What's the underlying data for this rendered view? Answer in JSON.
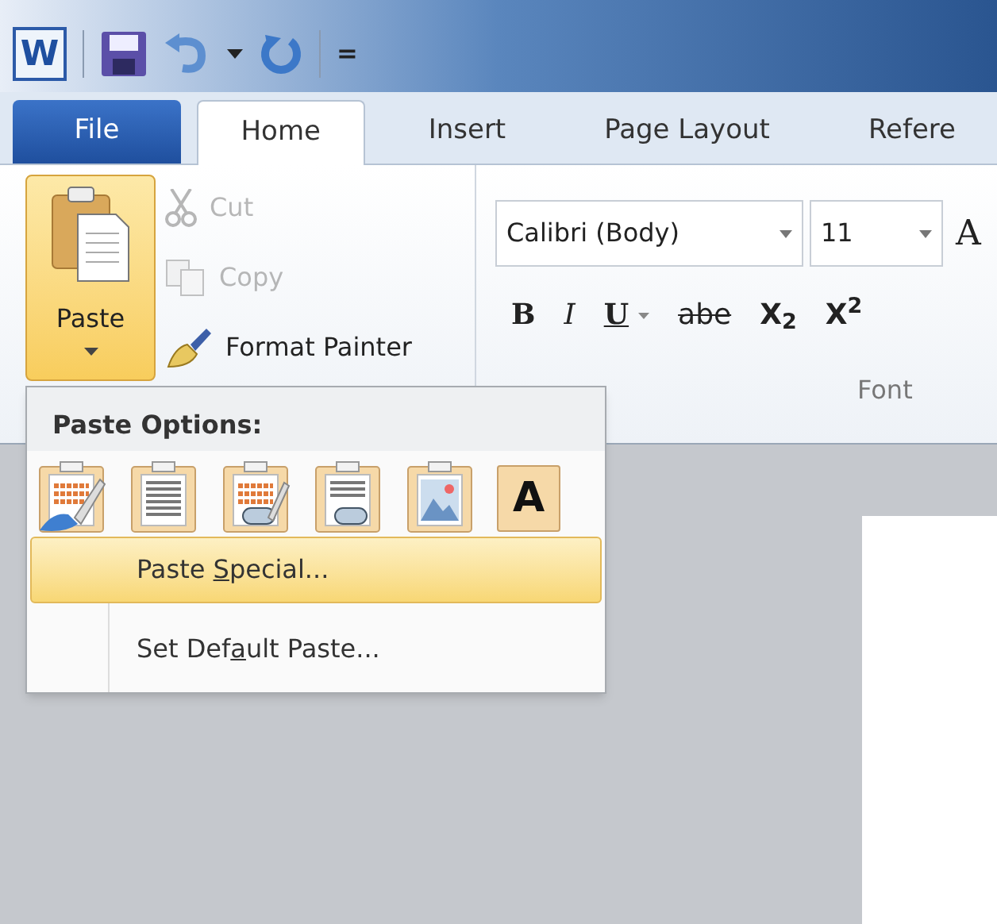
{
  "quick_access": {
    "app_letter": "W",
    "customize_glyph": "="
  },
  "tabs": [
    {
      "label": "File",
      "kind": "backstage",
      "selected": false
    },
    {
      "label": "Home",
      "kind": "tab",
      "selected": true
    },
    {
      "label": "Insert",
      "kind": "tab",
      "selected": false
    },
    {
      "label": "Page Layout",
      "kind": "tab",
      "selected": false
    },
    {
      "label": "Refere",
      "kind": "tab",
      "selected": false
    }
  ],
  "clipboard": {
    "paste": {
      "label": "Paste",
      "pressed": true
    },
    "commands": [
      {
        "label": "Cut",
        "kind": "cut",
        "disabled": true
      },
      {
        "label": "Copy",
        "kind": "copy",
        "disabled": true
      },
      {
        "label": "Format Painter",
        "kind": "painter",
        "disabled": false
      }
    ]
  },
  "font": {
    "name": "Calibri (Body)",
    "size": "11",
    "grow_letter": "A",
    "format_buttons": [
      {
        "label": "B",
        "kind": "bold"
      },
      {
        "label": "I",
        "kind": "italic"
      },
      {
        "label": "U",
        "kind": "underline"
      },
      {
        "label": "abe",
        "kind": "strike"
      },
      {
        "label": "X$_{2}$",
        "kind": "sub"
      },
      {
        "label": "X$^{2}$",
        "kind": "sup"
      }
    ],
    "group_label": "Font"
  },
  "paste_menu": {
    "header": "Paste Options:",
    "options": [
      {
        "kind": "keep_source"
      },
      {
        "kind": "text_lines"
      },
      {
        "kind": "merge"
      },
      {
        "kind": "link"
      },
      {
        "kind": "picture"
      },
      {
        "kind": "letter",
        "letter": "A"
      }
    ],
    "items": [
      {
        "selected": true,
        "label_parts": [
          {
            "text": "Paste ",
            "underlined": false
          },
          {
            "text": "S",
            "underlined": true
          },
          {
            "text": "pecial...",
            "underlined": false
          }
        ]
      },
      {
        "selected": false,
        "label_parts": [
          {
            "text": "Set Def",
            "underlined": false
          },
          {
            "text": "a",
            "underlined": true
          },
          {
            "text": "ult Paste...",
            "underlined": false
          }
        ]
      }
    ]
  }
}
